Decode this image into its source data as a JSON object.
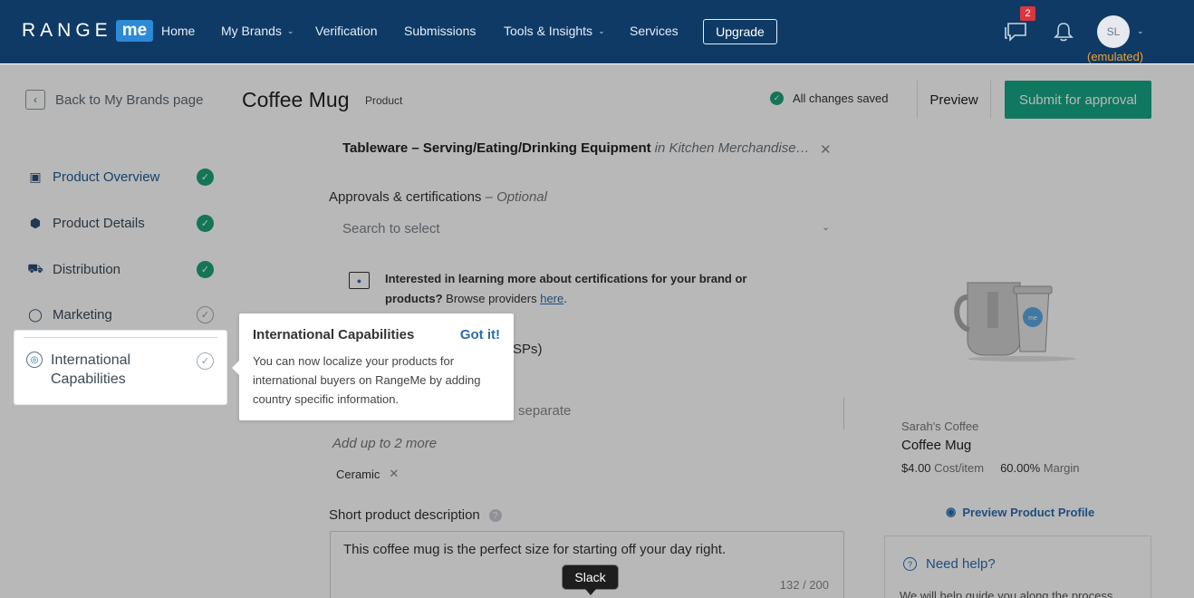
{
  "nav": {
    "logo_text": "RANGE",
    "logo_badge": "me",
    "items": [
      {
        "label": "Home",
        "has_dropdown": false
      },
      {
        "label": "My Brands",
        "has_dropdown": true
      },
      {
        "label": "Verification",
        "has_dropdown": false
      },
      {
        "label": "Submissions",
        "has_dropdown": false
      },
      {
        "label": "Tools & Insights",
        "has_dropdown": true
      },
      {
        "label": "Services",
        "has_dropdown": false
      }
    ],
    "upgrade_label": "Upgrade",
    "messages_count": "2",
    "avatar_initials": "SL",
    "emulated_label": "(emulated)"
  },
  "header": {
    "back_label": "Back to My Brands page",
    "title": "Coffee Mug",
    "type_label": "Product",
    "saved_status": "All changes saved",
    "preview_label": "Preview",
    "submit_label": "Submit for approval"
  },
  "sidebar": {
    "items": [
      {
        "label": "Product Overview",
        "icon": "document-icon",
        "complete": true
      },
      {
        "label": "Product Details",
        "icon": "box-icon",
        "complete": true
      },
      {
        "label": "Distribution",
        "icon": "truck-icon",
        "complete": true
      },
      {
        "label": "Marketing",
        "icon": "lightbulb-icon",
        "complete": false
      },
      {
        "label": "International Capabilities",
        "icon": "globe-icon",
        "complete": false
      }
    ]
  },
  "popover": {
    "title": "International Capabilities",
    "dismiss_label": "Got it!",
    "body": "You can now localize your products for international buyers on RangeMe by adding country specific information."
  },
  "form": {
    "category_main": "Tableware – Serving/Eating/Drinking Equipment",
    "category_parent": "in Kitchen Merchandise…",
    "approvals_label": "Approvals & certifications",
    "approvals_optional": "– Optional",
    "approvals_placeholder": "Search to select",
    "info_bold": "Interested in learning more about certifications for your brand or products?",
    "info_rest": " Browse providers ",
    "info_link": "here",
    "info_end": ".",
    "usp_partial": "SPs)",
    "keywords_partial": "separate",
    "add_more": "Add up to 2 more",
    "tag": "Ceramic",
    "short_desc_label": "Short product description",
    "short_desc_value": "This coffee mug is the perfect size for starting off your day right.",
    "char_count": "132 / 200"
  },
  "tooltip": {
    "label": "Slack"
  },
  "product_card": {
    "brand": "Sarah's Coffee",
    "name": "Coffee Mug",
    "cost": "$4.00",
    "cost_label": "Cost/item",
    "margin": "60.00%",
    "margin_label": "Margin",
    "preview_profile_label": "Preview Product Profile"
  },
  "help_card": {
    "title": "Need help?",
    "body": "We will help guide you along the process"
  },
  "colors": {
    "nav_bg": "#0f3a66",
    "accent": "#17a686",
    "link": "#2a6cb0",
    "badge": "#d9363e",
    "emulated": "#f0a030"
  }
}
